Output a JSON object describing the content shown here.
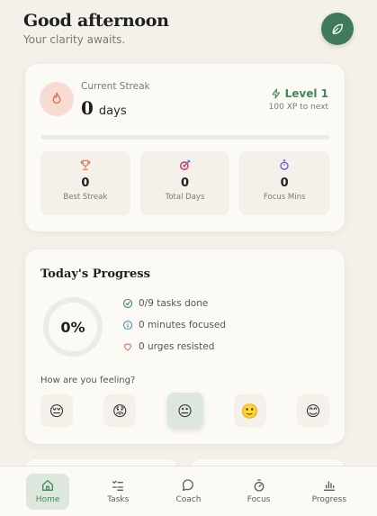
{
  "header": {
    "greeting": "Good afternoon",
    "subtitle": "Your clarity awaits."
  },
  "streak": {
    "label": "Current Streak",
    "value": "0",
    "unit": "days",
    "level_label": "Level 1",
    "xp_text": "100 XP to next",
    "xp_fraction": 0.0
  },
  "stats": [
    {
      "icon": "trophy-icon",
      "value": "0",
      "label": "Best Streak"
    },
    {
      "icon": "target-icon",
      "value": "0",
      "label": "Total Days"
    },
    {
      "icon": "stopwatch-icon",
      "value": "0",
      "label": "Focus Mins"
    }
  ],
  "progress": {
    "title": "Today's Progress",
    "percent_text": "0%",
    "items": [
      {
        "icon": "check-circle-icon",
        "text": "0/9 tasks done"
      },
      {
        "icon": "info-icon",
        "text": "0 minutes focused"
      },
      {
        "icon": "heart-icon",
        "text": "0 urges resisted"
      }
    ],
    "feeling_label": "How are you feeling?",
    "moods": [
      "😔",
      "😟",
      "😐",
      "🙂",
      "😊"
    ],
    "selected_mood_index": 2
  },
  "nav": {
    "items": [
      {
        "label": "Home",
        "icon": "home-icon"
      },
      {
        "label": "Tasks",
        "icon": "tasks-icon"
      },
      {
        "label": "Coach",
        "icon": "chat-icon"
      },
      {
        "label": "Focus",
        "icon": "timer-icon"
      },
      {
        "label": "Progress",
        "icon": "bar-chart-icon"
      }
    ],
    "active_index": 0
  },
  "colors": {
    "accent": "#3f8a5a",
    "accent_dark": "#3f7a5c",
    "background": "#f3f1ea",
    "card": "#fbfaf5",
    "flame_bg": "#f6dcd3",
    "flame": "#e0765a"
  }
}
